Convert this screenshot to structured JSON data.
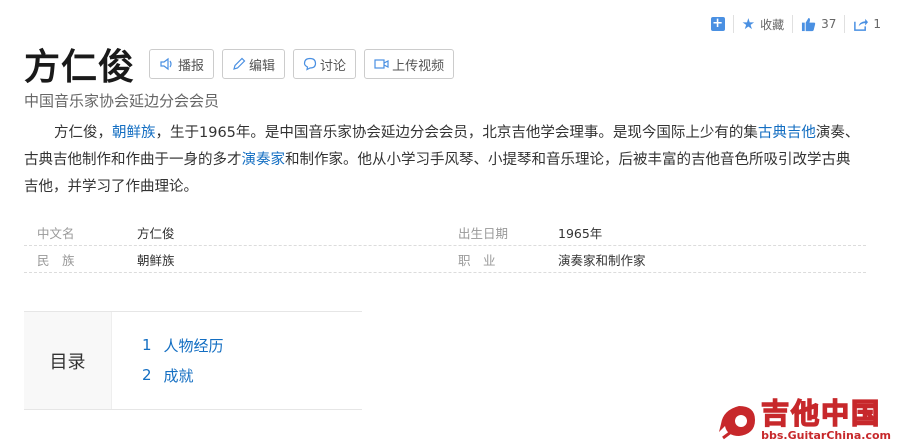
{
  "toolbar": {
    "favorite_label": "收藏",
    "like_count": "37",
    "share_count": "1"
  },
  "title": "方仁俊",
  "actions": {
    "broadcast": "播报",
    "edit": "编辑",
    "discuss": "讨论",
    "upload_video": "上传视频"
  },
  "subtitle": "中国音乐家协会延边分会会员",
  "summary": {
    "p1": "方仁俊，",
    "link1": "朝鲜族",
    "p2": "，生于1965年。是中国音乐家协会延边分会会员，北京吉他学会理事。是现今国际上少有的集",
    "link2": "古典吉他",
    "p3": "演奏、古典吉他制作和作曲于一身的多才",
    "link3": "演奏家",
    "p4": "和制作家。他从小学习手风琴、小提琴和音乐理论，后被丰富的吉他音色所吸引改学古典吉他，并学习了作曲理论。"
  },
  "info": {
    "rows": [
      {
        "k1": "中文名",
        "v1": "方仁俊",
        "k2": "出生日期",
        "v2": "1965年"
      },
      {
        "k1": "民　族",
        "v1": "朝鲜族",
        "k2": "职　业",
        "v2": "演奏家和制作家"
      }
    ]
  },
  "toc": {
    "label": "目录",
    "items": [
      {
        "num": "1",
        "text": "人物经历"
      },
      {
        "num": "2",
        "text": "成就"
      }
    ]
  },
  "watermark": {
    "name": "吉他中国",
    "url": "bbs.GuitarChina.com"
  },
  "colors": {
    "link": "#136ec2",
    "accent": "#4a90e2",
    "watermark": "#c7282b"
  }
}
